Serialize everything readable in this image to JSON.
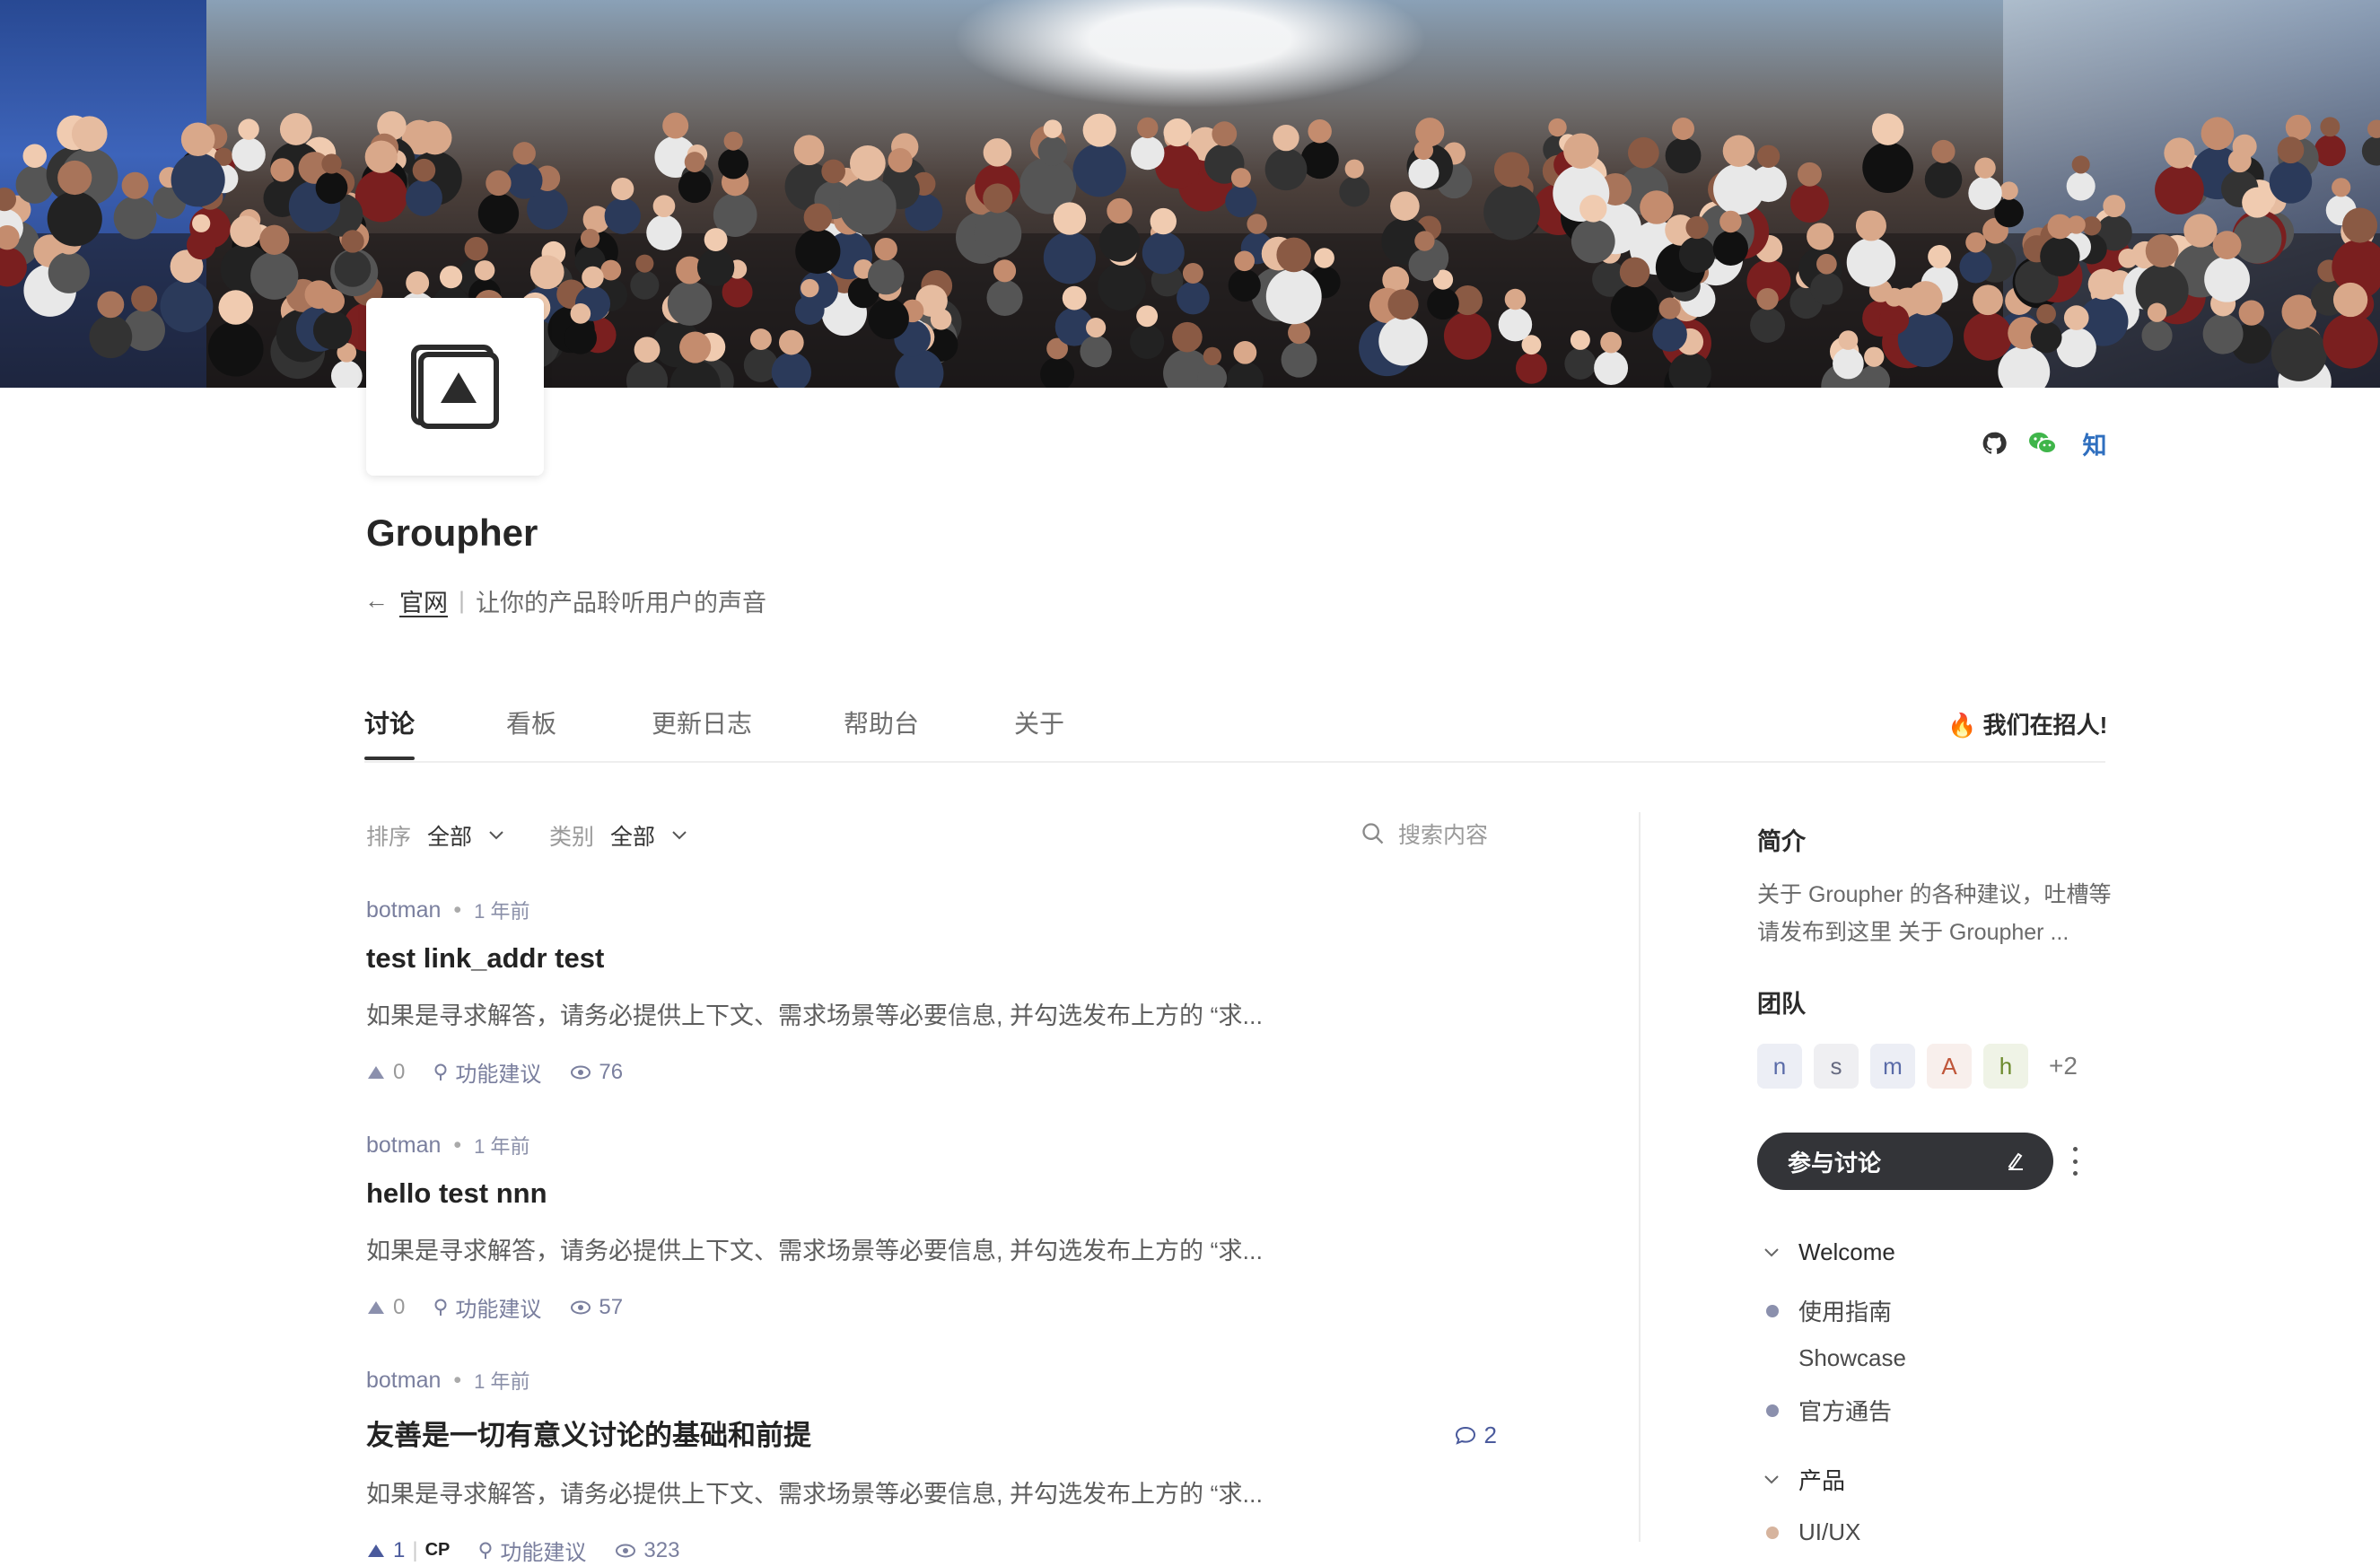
{
  "banner": {
    "alt": ""
  },
  "logo": {
    "icon": "grouphers-logo-icon"
  },
  "social": {
    "zhihu_label": "知"
  },
  "header": {
    "title": "Groupher",
    "back_arrow": "←",
    "website_link": "官网",
    "separator": "|",
    "tagline": "让你的产品聆听用户的声音"
  },
  "tabs": [
    {
      "label": "讨论",
      "active": true
    },
    {
      "label": "看板"
    },
    {
      "label": "更新日志"
    },
    {
      "label": "帮助台"
    },
    {
      "label": "关于"
    }
  ],
  "hiring": {
    "emoji": "🔥",
    "label": "我们在招人!"
  },
  "filters": {
    "sort_label": "排序",
    "sort_value": "全部",
    "category_label": "类别",
    "category_value": "全部"
  },
  "search": {
    "placeholder": "搜索内容"
  },
  "posts": [
    {
      "author": "botman",
      "time": "1 年前",
      "title": "test link_addr test",
      "desc": "如果是寻求解答，请务必提供上下文、需求场景等必要信息, 并勾选发布上方的 “求...",
      "upvotes": "0",
      "category": "功能建议",
      "views": "76"
    },
    {
      "author": "botman",
      "time": "1 年前",
      "title": "hello test nnn",
      "desc": "如果是寻求解答，请务必提供上下文、需求场景等必要信息, 并勾选发布上方的 “求...",
      "upvotes": "0",
      "category": "功能建议",
      "views": "57"
    },
    {
      "author": "botman",
      "time": "1 年前",
      "title": "友善是一切有意义讨论的基础和前提",
      "desc": "如果是寻求解答，请务必提供上下文、需求场景等必要信息, 并勾选发布上方的 “求...",
      "upvotes": "1",
      "upvoter": "CP",
      "category": "功能建议",
      "views": "323",
      "comments": "2"
    }
  ],
  "sidebar": {
    "intro_title": "简介",
    "intro_text": "关于 Groupher 的各种建议，吐槽等请发布到这里 关于 Groupher ...",
    "team_title": "团队",
    "team": [
      {
        "initial": "n",
        "bg": "#eceef5",
        "fg": "#5a6ba8"
      },
      {
        "initial": "s",
        "bg": "#efeff2",
        "fg": "#666a80"
      },
      {
        "initial": "m",
        "bg": "#eceef5",
        "fg": "#5a6ba8"
      },
      {
        "initial": "A",
        "bg": "#f8efec",
        "fg": "#c0563a"
      },
      {
        "initial": "h",
        "bg": "#eff3e6",
        "fg": "#6c8a2c"
      }
    ],
    "team_more": "+2",
    "join_label": "参与讨论",
    "groups": [
      {
        "label": "Welcome"
      },
      {
        "label": "产品"
      }
    ],
    "items": [
      {
        "label": "使用指南",
        "color": "#8b90ad"
      },
      {
        "label": "Showcase",
        "color": ""
      },
      {
        "label": "官方通告",
        "color": "#8b90ad"
      },
      {
        "label": "UI/UX",
        "color": "#d6b49e"
      }
    ]
  }
}
